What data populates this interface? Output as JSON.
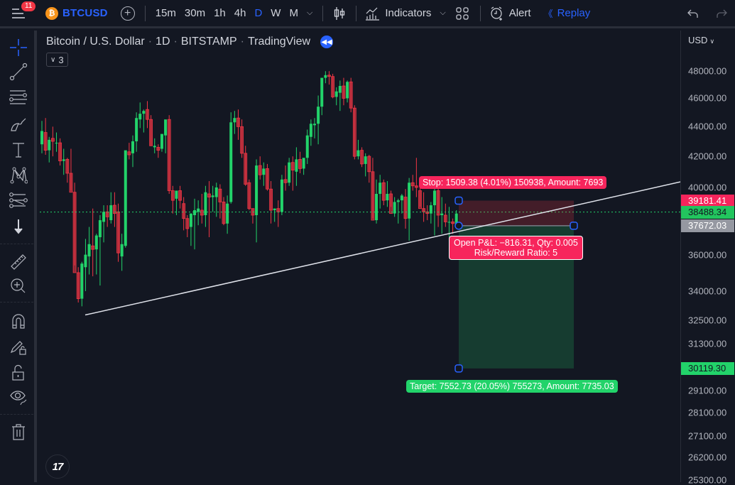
{
  "topbar": {
    "notification_count": "11",
    "symbol": "BTCUSD",
    "symbol_logo": "₿",
    "intervals": [
      "15m",
      "30m",
      "1h",
      "4h",
      "D",
      "W",
      "M"
    ],
    "active_interval": "D",
    "indicators_label": "Indicators",
    "alert_label": "Alert",
    "replay_label": "Replay"
  },
  "left_toolbar": {
    "tools": [
      "crosshair",
      "trend-line",
      "fib-retracement",
      "brush",
      "text",
      "pattern",
      "prediction",
      "arrow-down",
      "ruler",
      "zoom-in",
      "magnet",
      "lock-drawing",
      "lock",
      "eye",
      "trash"
    ]
  },
  "chart_header": {
    "name": "Bitcoin / U.S. Dollar",
    "interval": "1D",
    "exchange": "BITSTAMP",
    "source": "TradingView",
    "collapsed_count": "3"
  },
  "price_axis": {
    "currency": "USD",
    "ticks": [
      "48000.00",
      "46000.00",
      "44000.00",
      "42000.00",
      "40000.00",
      "36000.00",
      "34000.00",
      "32500.00",
      "31300.00",
      "29100.00",
      "28100.00",
      "27100.00",
      "26200.00",
      "25300.00"
    ],
    "tick_values": [
      48000,
      46000,
      44000,
      42000,
      40000,
      36000,
      34000,
      32500,
      31300,
      29100,
      28100,
      27100,
      26200,
      25300
    ],
    "labels": [
      {
        "text": "39181.41",
        "value": 39181.41,
        "bg": "#f7255c",
        "color": "#ffffff"
      },
      {
        "text": "38488.34",
        "value": 38488.34,
        "bg": "#22c55e",
        "color": "#131722"
      },
      {
        "text": "37672.03",
        "value": 37672.03,
        "bg": "#9598a1",
        "color": "#ffffff"
      },
      {
        "text": "30119.30",
        "value": 30119.3,
        "bg": "#22d36a",
        "color": "#131722"
      }
    ]
  },
  "position": {
    "type": "short",
    "entry": 37672.03,
    "stop": 39181.41,
    "target": 30119.3,
    "stop_label": "Stop: 1509.38 (4.01%) 150938, Amount: 7693",
    "pnl_label": "Open P&L: −816.31, Qty: 0.005",
    "rr_label": "Risk/Reward Ratio: 5",
    "target_label": "Target: 7552.73 (20.05%) 755273, Amount: 7735.03",
    "colors": {
      "stop": "#f7255c",
      "target": "#22d36a",
      "handle": "#2962ff"
    }
  },
  "trendline": {
    "start_price": 32900,
    "end_price": 40350
  },
  "chart_data": {
    "type": "candlestick",
    "title": "Bitcoin / U.S. Dollar · 1D · BITSTAMP",
    "scale": "log",
    "ylim": [
      25000,
      49500
    ],
    "last_price": 38488.34,
    "colors": {
      "up": "#22d36a",
      "down": "#f23645"
    },
    "ohlc": [
      [
        42800,
        44400,
        42200,
        43700
      ],
      [
        43600,
        44600,
        42100,
        42400
      ],
      [
        42400,
        43300,
        41600,
        43100
      ],
      [
        43200,
        44000,
        42000,
        43000
      ],
      [
        42900,
        43600,
        42300,
        42900
      ],
      [
        42900,
        43200,
        41400,
        41700
      ],
      [
        41700,
        42500,
        40800,
        41800
      ],
      [
        41800,
        41900,
        40300,
        40900
      ],
      [
        40900,
        42500,
        39800,
        39700
      ],
      [
        39700,
        40300,
        35400,
        35000
      ],
      [
        35000,
        35300,
        33400,
        33600
      ],
      [
        33600,
        35600,
        33200,
        35500
      ],
      [
        35300,
        36900,
        34000,
        36000
      ],
      [
        35900,
        37600,
        34900,
        36600
      ],
      [
        36500,
        38700,
        34800,
        36300
      ],
      [
        36300,
        37200,
        34900,
        37100
      ],
      [
        37000,
        38300,
        34300,
        38000
      ],
      [
        37900,
        38900,
        36700,
        38500
      ],
      [
        38500,
        38900,
        37600,
        38200
      ],
      [
        38000,
        39700,
        37800,
        38900
      ],
      [
        38900,
        39700,
        37600,
        38400
      ],
      [
        38500,
        39000,
        35600,
        36100
      ],
      [
        35900,
        37200,
        35100,
        36600
      ],
      [
        36500,
        42200,
        36400,
        42400
      ],
      [
        42300,
        42900,
        41800,
        42100
      ],
      [
        42200,
        43400,
        41300,
        43000
      ],
      [
        43000,
        45000,
        42300,
        44600
      ],
      [
        44500,
        45700,
        43900,
        44900
      ],
      [
        44900,
        45200,
        43600,
        45100
      ],
      [
        45200,
        45800,
        43900,
        44500
      ],
      [
        44500,
        44800,
        42700,
        42700
      ],
      [
        42600,
        43200,
        42200,
        42700
      ],
      [
        42600,
        42800,
        41900,
        42400
      ],
      [
        42500,
        43200,
        42300,
        43500
      ],
      [
        43400,
        44200,
        42200,
        44500
      ],
      [
        44500,
        44800,
        39600,
        39800
      ],
      [
        39800,
        40100,
        38400,
        39200
      ],
      [
        39300,
        39600,
        38300,
        39800
      ],
      [
        39800,
        40100,
        38700,
        39200
      ],
      [
        39000,
        39400,
        37400,
        38100
      ],
      [
        38100,
        38300,
        37000,
        37500
      ],
      [
        37600,
        38400,
        36500,
        38400
      ],
      [
        38300,
        39300,
        36300,
        38600
      ],
      [
        38500,
        39200,
        37700,
        38700
      ],
      [
        38600,
        39600,
        37800,
        38300
      ],
      [
        38300,
        40100,
        37600,
        39700
      ],
      [
        39600,
        40400,
        37000,
        39400
      ],
      [
        39400,
        40100,
        38500,
        39500
      ],
      [
        39400,
        40300,
        38200,
        40000
      ],
      [
        39900,
        40200,
        38100,
        39100
      ],
      [
        39100,
        39400,
        37700,
        37800
      ],
      [
        37800,
        39500,
        37200,
        39000
      ],
      [
        39100,
        45000,
        39000,
        44300
      ],
      [
        44300,
        45100,
        43500,
        44600
      ],
      [
        44600,
        45200,
        43100,
        44000
      ],
      [
        44000,
        44500,
        41900,
        42200
      ],
      [
        42200,
        42700,
        40100,
        40200
      ],
      [
        40300,
        40500,
        38600,
        38700
      ],
      [
        38700,
        38700,
        37800,
        38300
      ],
      [
        38300,
        41800,
        36700,
        41400
      ],
      [
        41400,
        42000,
        40500,
        40800
      ],
      [
        40800,
        41600,
        40100,
        41200
      ],
      [
        41200,
        41500,
        39800,
        39900
      ],
      [
        39900,
        40400,
        37800,
        38600
      ],
      [
        38600,
        38700,
        37900,
        38700
      ],
      [
        38700,
        39200,
        37600,
        38500
      ],
      [
        38500,
        40800,
        38300,
        40500
      ],
      [
        40500,
        41400,
        39800,
        40300
      ],
      [
        40300,
        41900,
        40100,
        41600
      ],
      [
        41600,
        42000,
        39800,
        41100
      ],
      [
        41000,
        42600,
        40100,
        41800
      ],
      [
        41800,
        42300,
        40900,
        41200
      ],
      [
        41200,
        41800,
        40800,
        41900
      ],
      [
        41900,
        43800,
        41500,
        43400
      ],
      [
        43300,
        44500,
        42700,
        44200
      ],
      [
        44100,
        44600,
        43200,
        44200
      ],
      [
        44200,
        46200,
        42800,
        45400
      ],
      [
        45400,
        46400,
        44800,
        47500
      ],
      [
        47500,
        48000,
        47100,
        47700
      ],
      [
        47700,
        48000,
        47000,
        47600
      ],
      [
        47600,
        47800,
        46000,
        46100
      ],
      [
        46100,
        46800,
        45500,
        46500
      ],
      [
        46400,
        47300,
        45100,
        46900
      ],
      [
        46900,
        47500,
        45500,
        46000
      ],
      [
        46000,
        47300,
        45700,
        47200
      ],
      [
        47200,
        47500,
        45000,
        45300
      ],
      [
        45300,
        45500,
        41800,
        42000
      ],
      [
        42000,
        43100,
        41800,
        42400
      ],
      [
        42400,
        42600,
        41300,
        41500
      ],
      [
        41500,
        42200,
        40700,
        42000
      ],
      [
        42000,
        42100,
        40300,
        41000
      ],
      [
        41000,
        41900,
        38100,
        38000
      ],
      [
        38000,
        40500,
        37800,
        39600
      ],
      [
        39600,
        40800,
        38700,
        40300
      ],
      [
        40300,
        40500,
        38900,
        39200
      ],
      [
        39200,
        40400,
        38800,
        39600
      ],
      [
        39600,
        39800,
        38800,
        38400
      ],
      [
        38400,
        39400,
        38200,
        39100
      ],
      [
        39100,
        39300,
        37800,
        39200
      ],
      [
        39200,
        39600,
        38400,
        39500
      ],
      [
        39400,
        39900,
        37500,
        38100
      ],
      [
        38100,
        40600,
        36800,
        40300
      ],
      [
        40300,
        40800,
        39800,
        40100
      ],
      [
        40100,
        41900,
        39400,
        40000
      ],
      [
        39800,
        40200,
        38800,
        38700
      ],
      [
        38700,
        39700,
        37900,
        38500
      ],
      [
        38500,
        38900,
        38000,
        38400
      ],
      [
        38400,
        39100,
        37800,
        38900
      ],
      [
        38900,
        40000,
        37100,
        39800
      ],
      [
        39800,
        40100,
        37600,
        38300
      ],
      [
        38300,
        39400,
        37200,
        38400
      ],
      [
        38300,
        39000,
        37600,
        37900
      ],
      [
        37900,
        38800,
        37000,
        37900
      ],
      [
        37900,
        38100,
        37200,
        37800
      ],
      [
        37600,
        38600,
        37500,
        38400
      ]
    ]
  }
}
